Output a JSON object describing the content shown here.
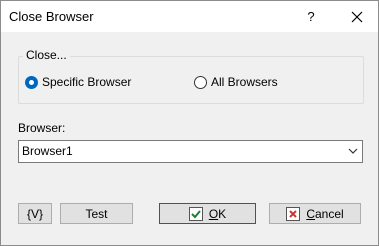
{
  "window": {
    "title": "Close Browser",
    "help_label": "?"
  },
  "close_group": {
    "legend": "Close...",
    "options": [
      {
        "label": "Specific Browser",
        "selected": true
      },
      {
        "label": "All Browsers",
        "selected": false
      }
    ]
  },
  "browser_field": {
    "label": "Browser:",
    "value": "Browser1"
  },
  "buttons": {
    "variable": "{V}",
    "test": "Test",
    "ok": "OK",
    "cancel": "Cancel"
  },
  "colors": {
    "accent": "#0067c0",
    "ok_check": "#1a7f37",
    "cancel_x": "#d13438"
  }
}
